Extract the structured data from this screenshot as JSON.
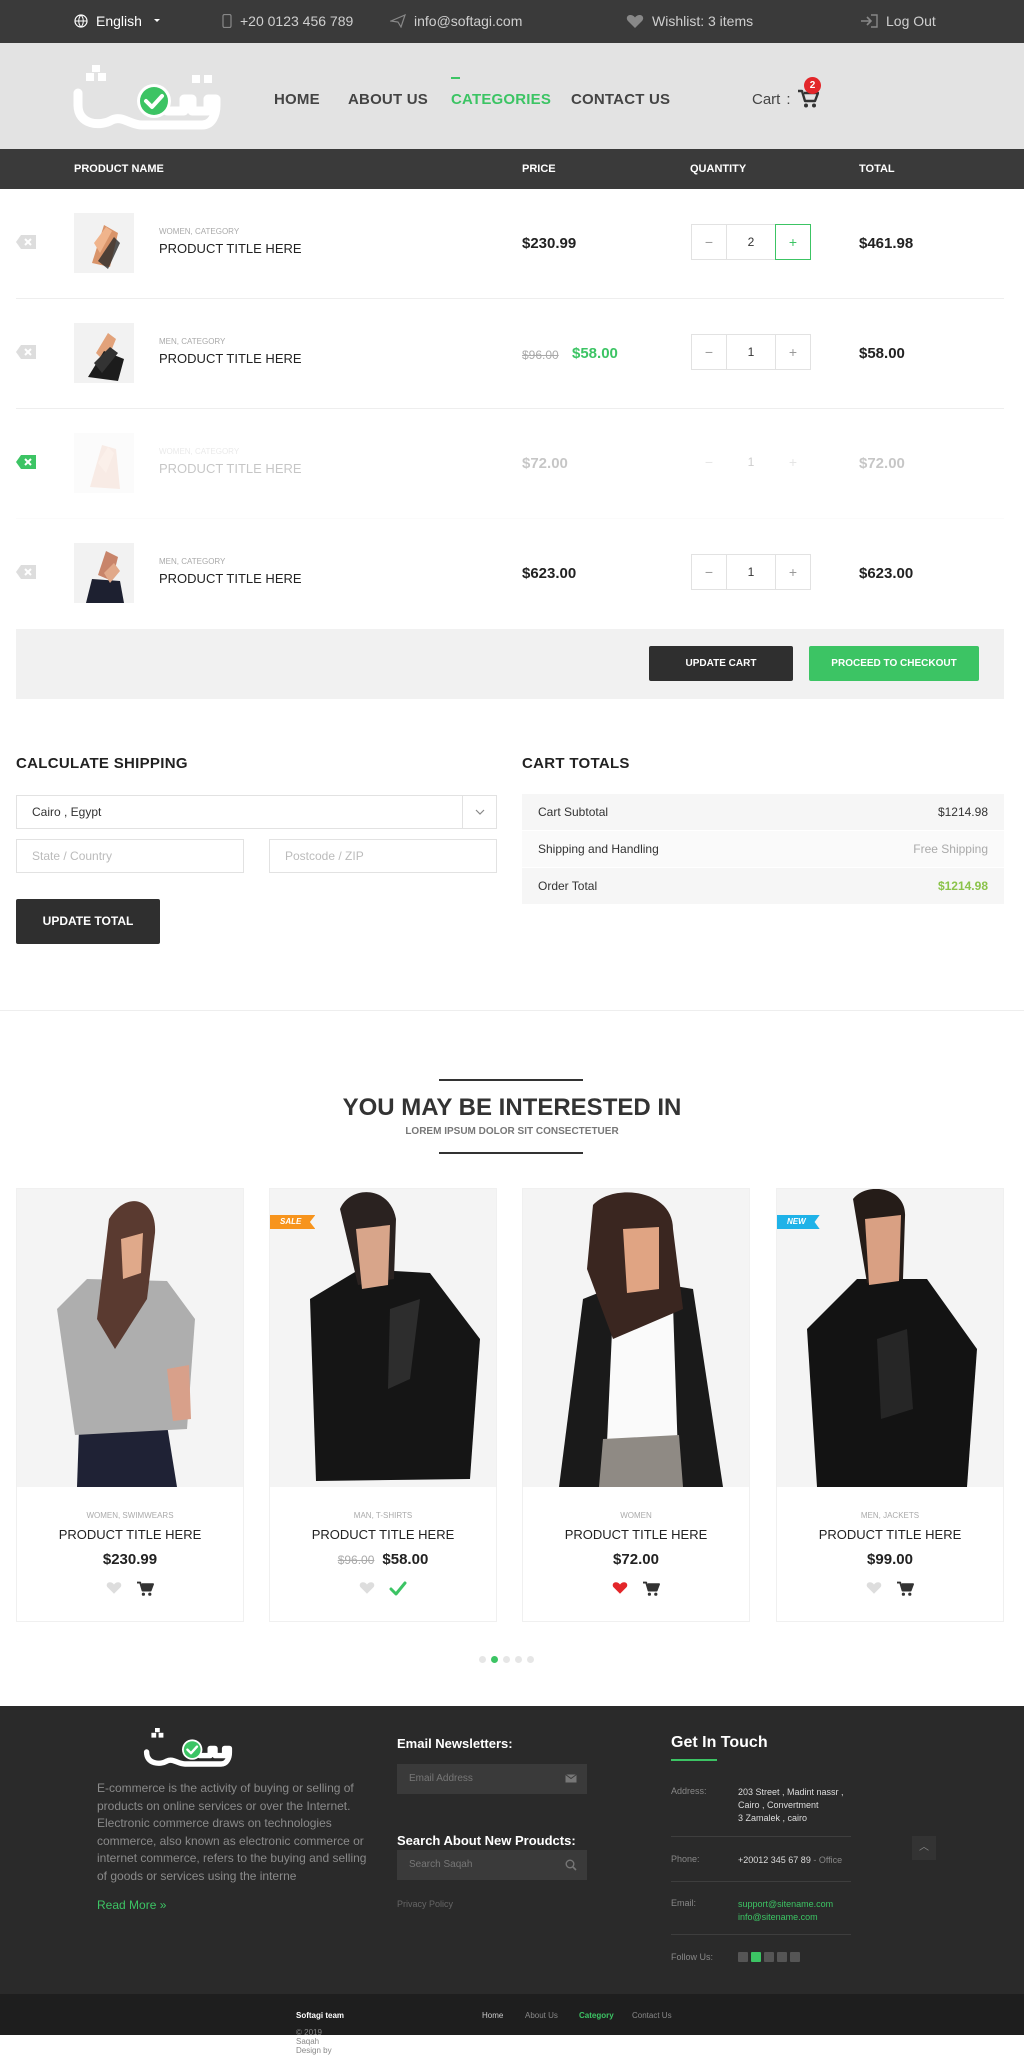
{
  "topbar": {
    "language": "English",
    "phone": "+20 0123 456 789",
    "email": "info@softagi.com",
    "wishlist": "Wishlist: 3 items",
    "logout": "Log Out"
  },
  "nav": {
    "home": "HOME",
    "about": "ABOUT US",
    "categories": "CATEGORIES",
    "contact": "CONTACT US",
    "cart_label": "Cart",
    "cart_count": "2"
  },
  "table": {
    "headers": {
      "name": "PRODUCT NAME",
      "price": "PRICE",
      "quantity": "QUANTITY",
      "total": "TOTAL"
    },
    "rows": [
      {
        "category": "WOMEN, CATEGORY",
        "title": "PRODUCT TITLE HERE",
        "price": "$230.99",
        "qty": "2",
        "total": "$461.98"
      },
      {
        "category": "MEN, CATEGORY",
        "title": "PRODUCT TITLE HERE",
        "old_price": "$96.00",
        "price": "$58.00",
        "qty": "1",
        "total": "$58.00"
      },
      {
        "category": "WOMEN, CATEGORY",
        "title": "PRODUCT TITLE HERE",
        "price": "$72.00",
        "qty": "1",
        "total": "$72.00"
      },
      {
        "category": "MEN, CATEGORY",
        "title": "PRODUCT TITLE HERE",
        "price": "$623.00",
        "qty": "1",
        "total": "$623.00"
      }
    ],
    "qty_minus": "−",
    "qty_plus": "+"
  },
  "actions": {
    "update_cart": "UPDATE CART",
    "checkout": "PROCEED TO CHECKOUT"
  },
  "shipping": {
    "title": "CALCULATE SHIPPING",
    "country": "Cairo , Egypt",
    "state_placeholder": "State / Country",
    "zip_placeholder": "Postcode / ZIP",
    "update_total": "UPDATE TOTAL"
  },
  "totals": {
    "title": "CART TOTALS",
    "subtotal_label": "Cart Subtotal",
    "subtotal": "$1214.98",
    "shipping_label": "Shipping and Handling",
    "shipping": "Free Shipping",
    "order_label": "Order Total",
    "order": "$1214.98"
  },
  "related": {
    "title": "YOU MAY BE INTERESTED IN",
    "subtitle": "LOREM IPSUM DOLOR SIT CONSECTETUER",
    "products": [
      {
        "category": "WOMEN, SWIMWEARS",
        "title": "PRODUCT TITLE HERE",
        "price": "$230.99",
        "ribbon": ""
      },
      {
        "category": "MAN, T-SHIRTS",
        "title": "PRODUCT TITLE HERE",
        "old_price": "$96.00",
        "price": "$58.00",
        "ribbon": "SALE"
      },
      {
        "category": "WOMEN",
        "title": "PRODUCT TITLE HERE",
        "price": "$72.00",
        "ribbon": ""
      },
      {
        "category": "MEN, JACKETS",
        "title": "PRODUCT TITLE HERE",
        "price": "$99.00",
        "ribbon": "NEW"
      }
    ]
  },
  "footer": {
    "description": "E-commerce is the activity of buying or selling of products on online services or over the Internet. Electronic commerce draws on technologies commerce, also known as electronic commerce or internet commerce, refers to the buying and selling of goods or services using the interne",
    "read_more": "Read More »",
    "newsletter_title": "Email Newsletters:",
    "email_placeholder": "Email Address",
    "search_title": "Search About New Proudcts:",
    "search_placeholder": "Search Saqah",
    "privacy": "Privacy Policy",
    "get_in_touch": "Get In Touch",
    "address_label": "Address:",
    "address_1": "203 Street , Madint nassr ,",
    "address_2": "Cairo , Convertment",
    "address_3": "3 Zamalek , cairo",
    "phone_label": "Phone:",
    "phone": "+20012 345 67 89",
    "phone_note": " - Office",
    "email_label": "Email:",
    "email_1": "support@sitename.com",
    "email_2": "info@sitename.com",
    "follow_label": "Follow Us:"
  },
  "bottom": {
    "copyright": "© 2019 Saqah Design by",
    "team": "Softagi team",
    "links": [
      "Home",
      "About Us",
      "Category",
      "Contact Us"
    ]
  },
  "colors": {
    "accent": "#3cc464",
    "dark": "#3a3a3a",
    "badge": "#e3262a",
    "sale": "#f7941d",
    "new": "#1eb2e8"
  }
}
